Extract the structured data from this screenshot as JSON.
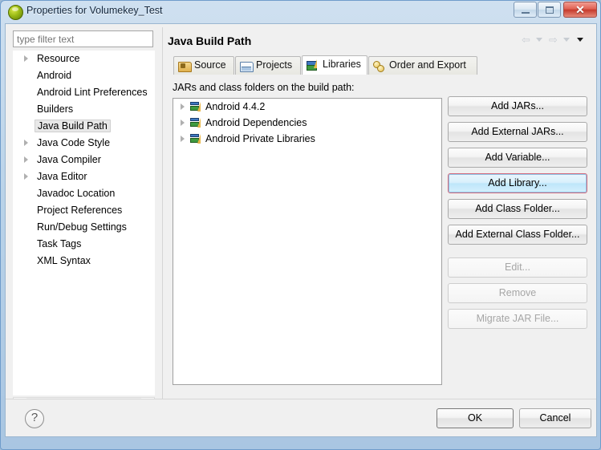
{
  "window": {
    "title": "Properties for Volumekey_Test",
    "icon": "eclipse-icon",
    "minimize_label": "",
    "maximize_label": "",
    "close_label": "✕"
  },
  "sidebar": {
    "filter_placeholder": "type filter text",
    "filter_value": "",
    "items": [
      {
        "label": "Resource",
        "expandable": true,
        "selected": false
      },
      {
        "label": "Android",
        "expandable": false,
        "selected": false
      },
      {
        "label": "Android Lint Preferences",
        "expandable": false,
        "selected": false
      },
      {
        "label": "Builders",
        "expandable": false,
        "selected": false
      },
      {
        "label": "Java Build Path",
        "expandable": false,
        "selected": true
      },
      {
        "label": "Java Code Style",
        "expandable": true,
        "selected": false
      },
      {
        "label": "Java Compiler",
        "expandable": true,
        "selected": false
      },
      {
        "label": "Java Editor",
        "expandable": true,
        "selected": false
      },
      {
        "label": "Javadoc Location",
        "expandable": false,
        "selected": false
      },
      {
        "label": "Project References",
        "expandable": false,
        "selected": false
      },
      {
        "label": "Run/Debug Settings",
        "expandable": false,
        "selected": false
      },
      {
        "label": "Task Tags",
        "expandable": false,
        "selected": false
      },
      {
        "label": "XML Syntax",
        "expandable": false,
        "selected": false
      }
    ]
  },
  "page": {
    "title": "Java Build Path",
    "nav": [
      {
        "name": "back-arrow-icon",
        "glyph": "⇦"
      },
      {
        "name": "back-dropdown-icon",
        "glyph": "▼"
      },
      {
        "name": "forward-arrow-icon",
        "glyph": "⇨"
      },
      {
        "name": "forward-dropdown-icon",
        "glyph": "▼"
      },
      {
        "name": "menu-dropdown-icon",
        "glyph": "▼"
      }
    ],
    "tabs": [
      {
        "label": "Source",
        "icon": "source-folder-icon",
        "active": false
      },
      {
        "label": "Projects",
        "icon": "projects-folder-icon",
        "active": false
      },
      {
        "label": "Libraries",
        "icon": "libraries-books-icon",
        "active": true
      },
      {
        "label": "Order and Export",
        "icon": "order-export-icon",
        "active": false
      }
    ],
    "list_label": "JARs and class folders on the build path:",
    "entries": [
      {
        "label": "Android 4.4.2",
        "icon": "library-icon",
        "expandable": true
      },
      {
        "label": "Android Dependencies",
        "icon": "library-icon",
        "expandable": true
      },
      {
        "label": "Android Private Libraries",
        "icon": "library-icon",
        "expandable": true
      }
    ],
    "buttons": [
      {
        "label": "Add JARs...",
        "state": "normal"
      },
      {
        "label": "Add External JARs...",
        "state": "normal"
      },
      {
        "label": "Add Variable...",
        "state": "normal"
      },
      {
        "label": "Add Library...",
        "state": "hover"
      },
      {
        "label": "Add Class Folder...",
        "state": "normal"
      },
      {
        "label": "Add External Class Folder...",
        "state": "normal"
      },
      {
        "label": "Edit...",
        "state": "disabled"
      },
      {
        "label": "Remove",
        "state": "disabled"
      },
      {
        "label": "Migrate JAR File...",
        "state": "disabled"
      }
    ]
  },
  "footer": {
    "help_label": "?",
    "ok_label": "OK",
    "cancel_label": "Cancel"
  },
  "colors": {
    "hover_border": "#d36b7d",
    "hover_fill": "#bee6fa",
    "title_bar": "#b9d2e8",
    "close_button": "#c53a2c"
  }
}
